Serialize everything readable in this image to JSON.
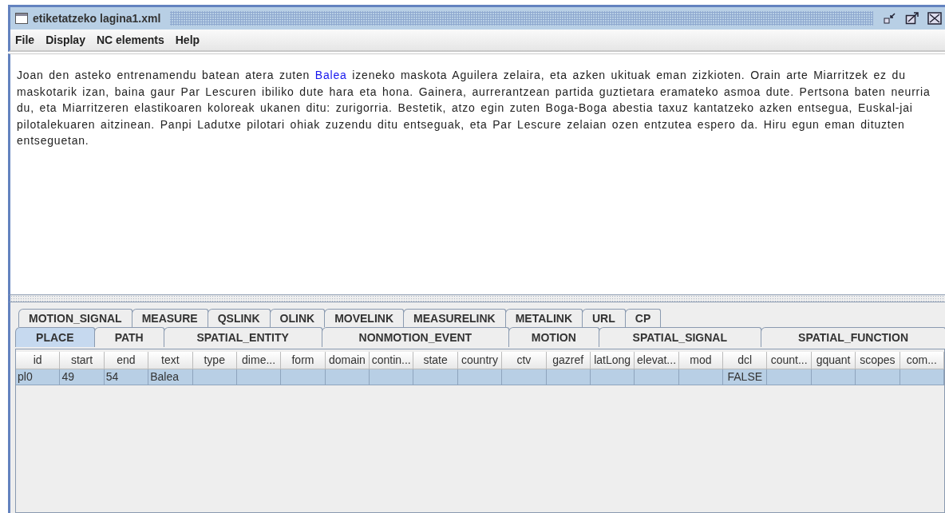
{
  "window": {
    "title": "etiketatzeko lagina1.xml"
  },
  "menu": [
    "File",
    "Display",
    "NC elements",
    "Help"
  ],
  "document": {
    "segments": [
      {
        "text": "Joan den asteko entrenamendu batean atera zuten ",
        "highlighted": false
      },
      {
        "text": "Balea",
        "highlighted": true
      },
      {
        "text": " izeneko maskota Aguilera zelaira, eta azken ukituak eman zizkioten. Orain arte Miarritzek ez du maskotarik izan, baina gaur Par Lescuren ibiliko dute hara eta hona. Gainera, aurrerantzean partida guztietara eramateko asmoa dute. Pertsona baten neurria du, eta Miarritzeren elastikoaren koloreak ukanen ditu: zurigorria. Bestetik, atzo egin zuten Boga-Boga abestia taxuz kantatzeko azken entsegua, Euskal-jai pilotalekuaren aitzinean. Panpi Ladutxe pilotari ohiak zuzendu ditu entseguak, eta Par Lescure zelaian ozen entzutea espero da. Hiru egun eman dituzten entseguetan.",
        "highlighted": false
      }
    ]
  },
  "tab_rows": [
    [
      {
        "label": "MOTION_SIGNAL",
        "selected": false
      },
      {
        "label": "MEASURE",
        "selected": false
      },
      {
        "label": "QSLINK",
        "selected": false
      },
      {
        "label": "OLINK",
        "selected": false
      },
      {
        "label": "MOVELINK",
        "selected": false
      },
      {
        "label": "MEASURELINK",
        "selected": false
      },
      {
        "label": "METALINK",
        "selected": false
      },
      {
        "label": "URL",
        "selected": false
      },
      {
        "label": "CP",
        "selected": false
      }
    ],
    [
      {
        "label": "PLACE",
        "selected": true
      },
      {
        "label": "PATH",
        "selected": false
      },
      {
        "label": "SPATIAL_ENTITY",
        "selected": false
      },
      {
        "label": "NONMOTION_EVENT",
        "selected": false
      },
      {
        "label": "MOTION",
        "selected": false
      },
      {
        "label": "SPATIAL_SIGNAL",
        "selected": false
      },
      {
        "label": "SPATIAL_FUNCTION",
        "selected": false
      }
    ]
  ],
  "table": {
    "columns": [
      "id",
      "start",
      "end",
      "text",
      "type",
      "dime...",
      "form",
      "domain",
      "contin...",
      "state",
      "country",
      "ctv",
      "gazref",
      "latLong",
      "elevat...",
      "mod",
      "dcl",
      "count...",
      "gquant",
      "scopes",
      "com..."
    ],
    "rows": [
      {
        "selected": true,
        "cells": [
          "pl0",
          "49",
          "54",
          "Balea",
          "",
          "",
          "",
          "",
          "",
          "",
          "",
          "",
          "",
          "",
          "",
          "",
          "FALSE",
          "",
          "",
          "",
          ""
        ]
      }
    ]
  }
}
